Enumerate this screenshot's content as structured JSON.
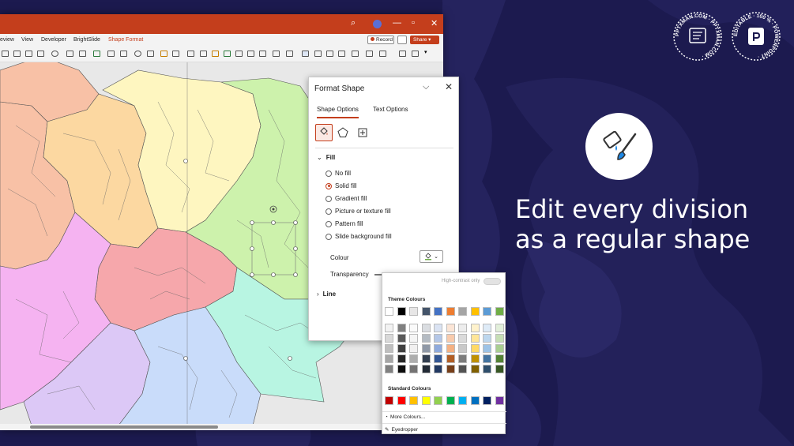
{
  "window": {
    "ribbon_tabs": [
      "eview",
      "View",
      "Developer",
      "BrightSlide",
      "Shape Format"
    ],
    "active_tab": "Shape Format",
    "record_label": "Record",
    "share_label": "Share"
  },
  "format_pane": {
    "title": "Format Shape",
    "tabs": [
      "Shape Options",
      "Text Options"
    ],
    "fill_section": "Fill",
    "fill_options": [
      {
        "label": "No fill",
        "checked": false
      },
      {
        "label": "Solid fill",
        "checked": true
      },
      {
        "label": "Gradient fill",
        "checked": false
      },
      {
        "label": "Picture or texture fill",
        "checked": false
      },
      {
        "label": "Pattern fill",
        "checked": false
      },
      {
        "label": "Slide background fill",
        "checked": false
      }
    ],
    "colour_label": "Colour",
    "transparency_label": "Transparency",
    "line_section": "Line"
  },
  "colour_picker": {
    "high_contrast_label": "High-contrast only",
    "theme_label": "Theme Colours",
    "standard_label": "Standard Colours",
    "more_colours": "More Colours...",
    "eyedropper": "Eyedropper",
    "theme_top": [
      "#ffffff",
      "#000000",
      "#e7e6e6",
      "#44546a",
      "#4472c4",
      "#ed7d31",
      "#a5a5a5",
      "#ffc000",
      "#5b9bd5",
      "#70ad47"
    ],
    "standard": [
      "#c00000",
      "#ff0000",
      "#ffc000",
      "#ffff00",
      "#92d050",
      "#00b050",
      "#00b0f0",
      "#0070c0",
      "#002060",
      "#7030a0"
    ]
  },
  "hero": {
    "line1": "Edit every division",
    "line2": "as a regular shape"
  },
  "badges": {
    "left_text": "PPTXMAN.COM · PPTXMAN.COM ·",
    "right_text": "EDITABLE · 100 % · POWERPOINT ·"
  },
  "colors": {
    "background": "#1c1a4f",
    "accent": "#c43e1c"
  }
}
